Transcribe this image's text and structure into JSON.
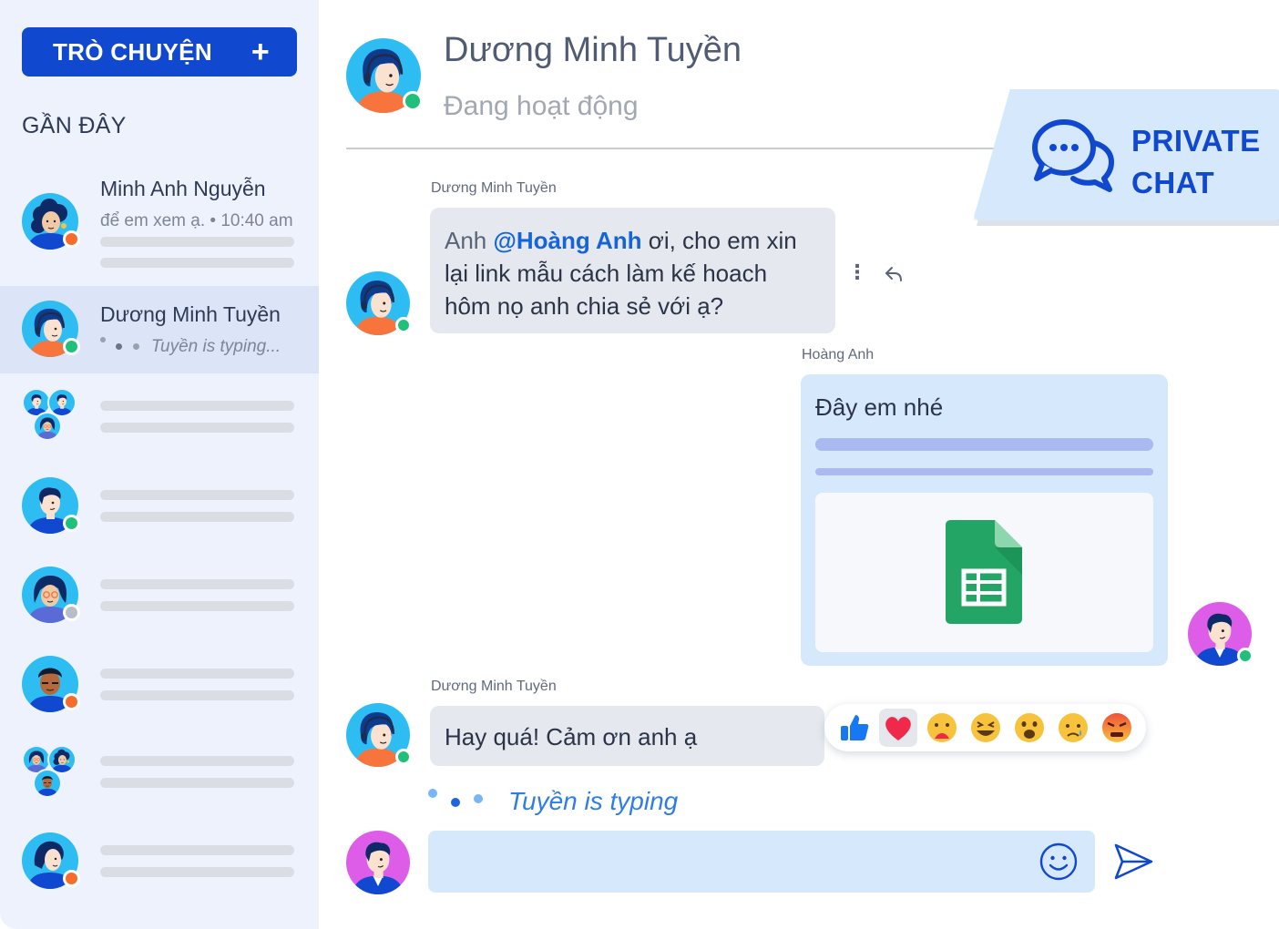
{
  "sidebar": {
    "new_chat_label": "TRÒ CHUYỆN",
    "new_chat_icon": "plus-icon",
    "recent_title": "GẦN ĐÂY",
    "conversations": [
      {
        "name": "Minh Anh Nguyễn",
        "preview": "để em xem ạ.",
        "time": "10:40 am",
        "status": "away"
      },
      {
        "name": "Dương Minh Tuyền",
        "typing": "Tuyền is typing...",
        "status": "online",
        "active": true
      }
    ]
  },
  "header": {
    "name": "Dương Minh Tuyền",
    "status": "Đang hoạt động"
  },
  "badge": {
    "line1": "PRIVATE",
    "line2": "CHAT",
    "icon": "chat-bubbles-icon"
  },
  "messages": [
    {
      "sender": "Dương Minh Tuyền",
      "prefix": "Anh ",
      "mention": "@Hoàng Anh",
      "line1_rest": " ơi, cho em xin",
      "line2": "lại link mẫu cách làm kế hoach",
      "line3": "hôm nọ anh chia sẻ với ạ?"
    },
    {
      "sender": "Hoàng Anh",
      "text": "Đây em nhé",
      "attachment": "spreadsheet-file-icon"
    },
    {
      "sender": "Dương Minh Tuyền",
      "text": "Hay quá! Cảm ơn anh ạ"
    }
  ],
  "reactions": [
    "like",
    "love",
    "care",
    "haha",
    "wow",
    "sad",
    "angry"
  ],
  "typing_indicator": "Tuyền is typing",
  "composer": {
    "placeholder": ""
  },
  "colors": {
    "primary": "#1148d0",
    "sidebar_bg": "#eef2fc",
    "active_row": "#dce4f8",
    "bubble_in": "#e5e9ef",
    "bubble_out": "#d6e8fb",
    "online": "#21c07a",
    "away": "#f76b2c",
    "offline": "#b8bec9",
    "mention": "#1565d8"
  }
}
